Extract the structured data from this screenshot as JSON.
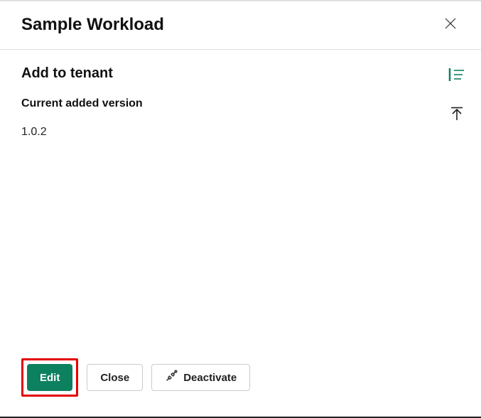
{
  "header": {
    "title": "Sample Workload"
  },
  "main": {
    "section_title": "Add to tenant",
    "version_label": "Current added version",
    "version_value": "1.0.2"
  },
  "footer": {
    "edit_label": "Edit",
    "close_label": "Close",
    "deactivate_label": "Deactivate"
  },
  "colors": {
    "accent": "#0d805f"
  }
}
